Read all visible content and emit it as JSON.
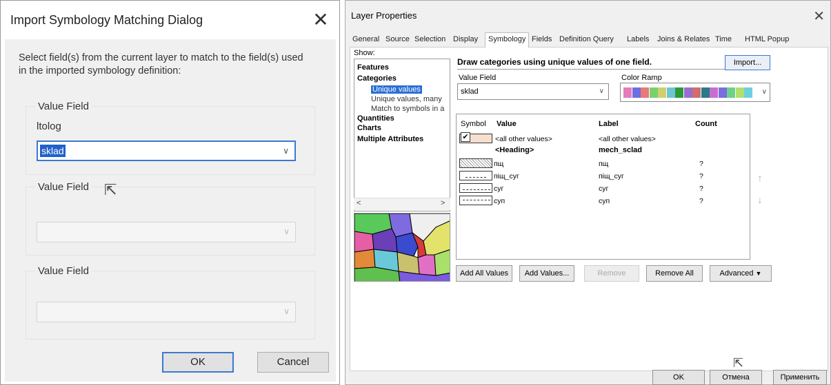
{
  "left_dialog": {
    "title": "Import Symbology Matching Dialog",
    "close": "✕",
    "instructions": "Select field(s) from the current layer to match to the field(s) used in the imported symbology definition:",
    "groups": [
      {
        "label": "Value Field",
        "sublabel": "ltolog",
        "value": "sklad"
      },
      {
        "label": "Value Field",
        "value": ""
      },
      {
        "label": "Value Field",
        "value": ""
      }
    ],
    "ok": "OK",
    "cancel": "Cancel"
  },
  "right_dialog": {
    "title": "Layer Properties",
    "close": "✕",
    "tabs": [
      "General",
      "Source",
      "Selection",
      "Display",
      "Symbology",
      "Fields",
      "Definition Query",
      "Labels",
      "Joins & Relates",
      "Time",
      "HTML Popup"
    ],
    "active_tab": "Symbology",
    "show_label": "Show:",
    "tree": {
      "features": "Features",
      "categories": "Categories",
      "unique_values": "Unique values",
      "unique_values_many": "Unique values, many",
      "match_symbols": "Match to symbols in a",
      "quantities": "Quantities",
      "charts": "Charts",
      "multiple_attributes": "Multiple Attributes"
    },
    "description": "Draw categories using unique values of one field.",
    "import_button": "Import...",
    "value_field_label": "Value Field",
    "value_field_value": "sklad",
    "color_ramp_label": "Color Ramp",
    "color_ramp": [
      "#e57bb9",
      "#6e6ee0",
      "#e97a7a",
      "#7bd06e",
      "#cfcf6e",
      "#6ec7d0",
      "#2a9a3a",
      "#9a6ed0",
      "#d06e6e",
      "#2a7a8a",
      "#c96ed0",
      "#7a6ee0",
      "#6ed08a",
      "#b0e06e",
      "#6ecfe0"
    ],
    "grid_headers": {
      "symbol": "Symbol",
      "value": "Value",
      "label": "Label",
      "count": "Count"
    },
    "rows": [
      {
        "value": "<all other values>",
        "label": "<all other values>",
        "count": ""
      },
      {
        "value": "<Heading>",
        "label": "mech_sclad",
        "count": ""
      },
      {
        "value": "пщ",
        "label": "пщ",
        "count": "?"
      },
      {
        "value": "піщ_суг",
        "label": "піщ_суг",
        "count": "?"
      },
      {
        "value": "суг",
        "label": "суг",
        "count": "?"
      },
      {
        "value": "суп",
        "label": "суп",
        "count": "?"
      }
    ],
    "buttons": {
      "add_all": "Add All Values",
      "add_values": "Add Values...",
      "remove": "Remove",
      "remove_all": "Remove All",
      "advanced": "Advanced"
    },
    "footer": {
      "ok": "OK",
      "cancel": "Отмена",
      "apply": "Применить"
    }
  }
}
